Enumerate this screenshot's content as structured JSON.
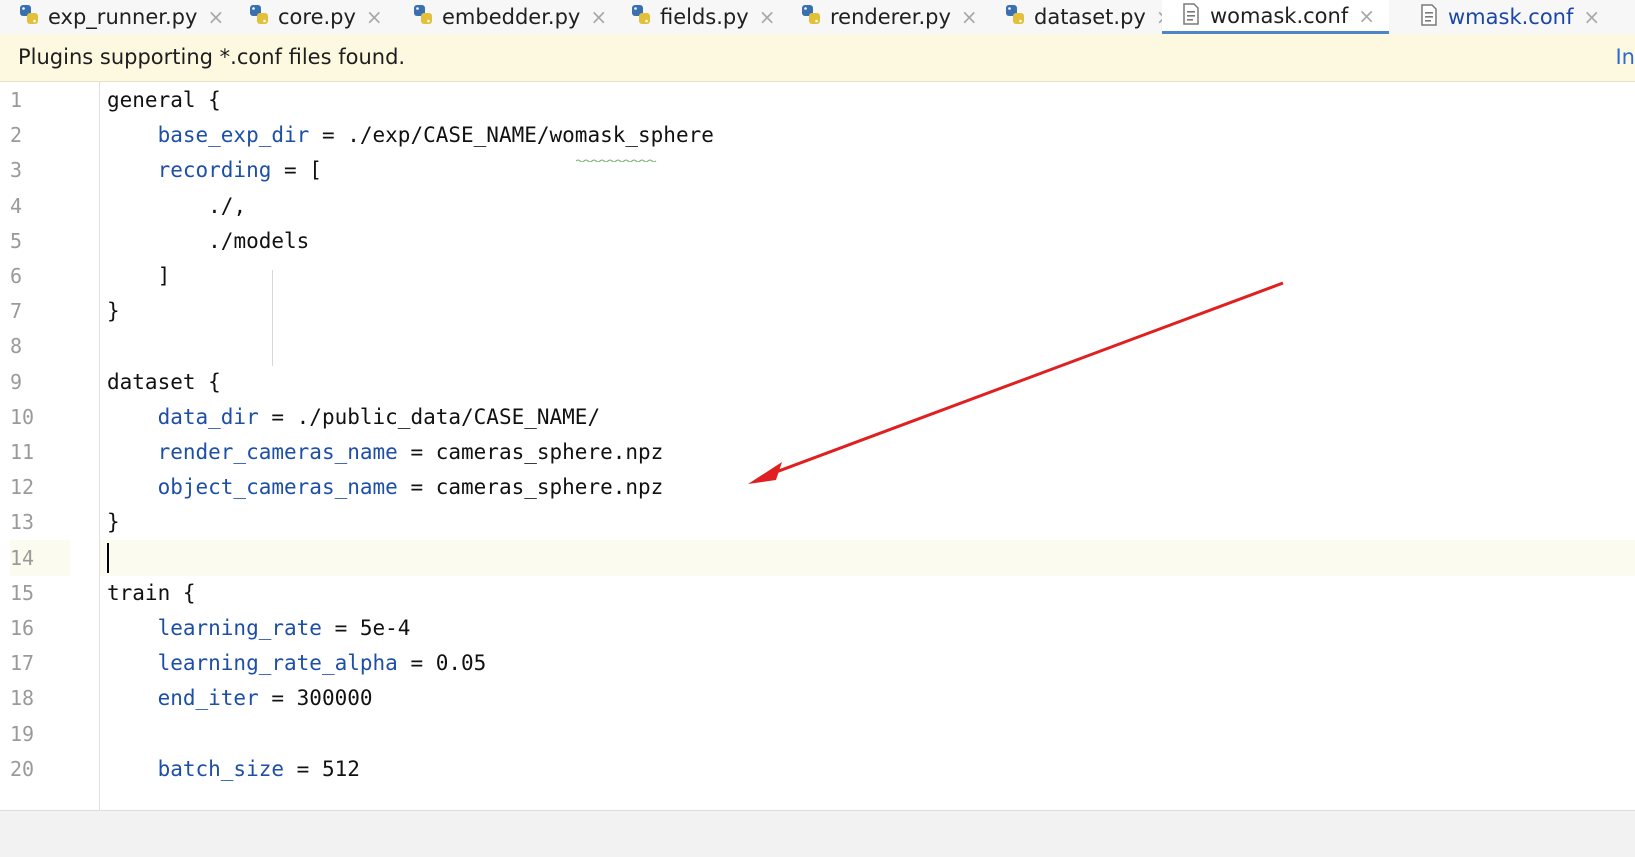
{
  "tabs": [
    {
      "label": "exp_runner.py",
      "icon": "python-file-icon"
    },
    {
      "label": "core.py",
      "icon": "python-file-icon"
    },
    {
      "label": "embedder.py",
      "icon": "python-file-icon"
    },
    {
      "label": "fields.py",
      "icon": "python-file-icon"
    },
    {
      "label": "renderer.py",
      "icon": "python-file-icon"
    },
    {
      "label": "dataset.py",
      "icon": "python-file-icon"
    },
    {
      "label": "womask.conf",
      "icon": "text-file-icon",
      "active": true
    },
    {
      "label": "wmask.conf",
      "icon": "text-file-icon"
    }
  ],
  "tab_close_glyph": "×",
  "banner": {
    "message": "Plugins supporting *.conf files found.",
    "action": "In"
  },
  "editor": {
    "current_line": 14,
    "line_numbers": [
      "1",
      "2",
      "3",
      "4",
      "5",
      "6",
      "7",
      "8",
      "9",
      "10",
      "11",
      "12",
      "13",
      "14",
      "15",
      "16",
      "17",
      "18",
      "19",
      "20"
    ],
    "lines": [
      {
        "key": "general {",
        "rest": ""
      },
      {
        "indent": "    ",
        "key": "base_exp_dir",
        "rest": " = ./exp/CASE_NAME/womask_sphere"
      },
      {
        "indent": "    ",
        "key": "recording",
        "rest": " = ["
      },
      {
        "indent": "        ",
        "key": "",
        "rest": "./,"
      },
      {
        "indent": "        ",
        "key": "",
        "rest": "./models"
      },
      {
        "indent": "    ",
        "key": "",
        "rest": "]"
      },
      {
        "key": "",
        "rest": "}"
      },
      {
        "key": "",
        "rest": ""
      },
      {
        "key": "",
        "rest": "dataset {"
      },
      {
        "indent": "    ",
        "key": "data_dir",
        "rest": " = ./public_data/CASE_NAME/"
      },
      {
        "indent": "    ",
        "key": "render_cameras_name",
        "rest": " = cameras_sphere.npz"
      },
      {
        "indent": "    ",
        "key": "object_cameras_name",
        "rest": " = cameras_sphere.npz"
      },
      {
        "key": "",
        "rest": "}"
      },
      {
        "key": "",
        "rest": ""
      },
      {
        "key": "",
        "rest": "train {"
      },
      {
        "indent": "    ",
        "key": "learning_rate",
        "rest": " = 5e-4"
      },
      {
        "indent": "    ",
        "key": "learning_rate_alpha",
        "rest": " = 0.05"
      },
      {
        "indent": "    ",
        "key": "end_iter",
        "rest": " = 300000"
      },
      {
        "key": "",
        "rest": ""
      },
      {
        "indent": "    ",
        "key": "batch_size",
        "rest": " = 512"
      }
    ]
  },
  "colors": {
    "key": "#1d4fa8",
    "text": "#111111",
    "annotation_arrow": "#e02020",
    "active_tab_underline": "#4a86c8",
    "banner_bg": "#fdf8e0"
  }
}
